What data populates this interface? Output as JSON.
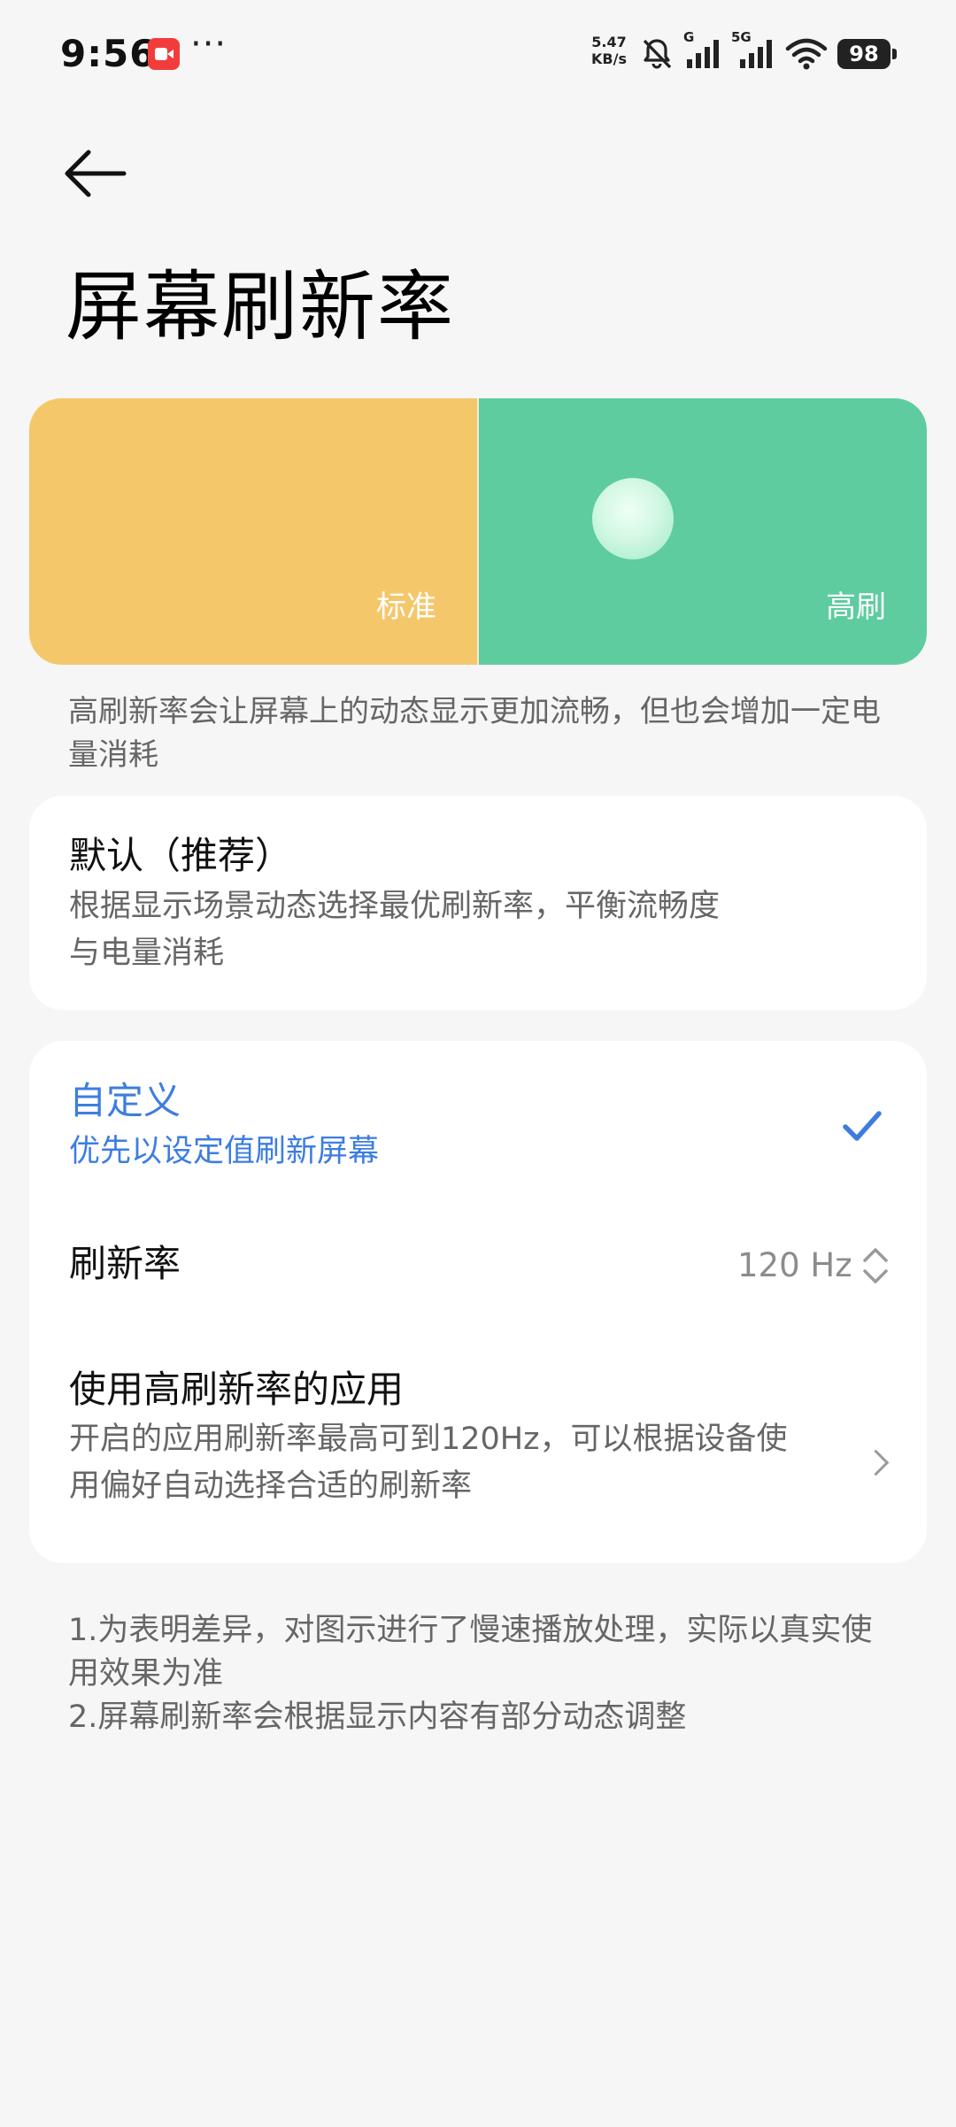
{
  "status_bar": {
    "time": "9:56",
    "more": "···",
    "net_speed_value": "5.47",
    "net_speed_unit": "KB/s",
    "sim1_label": "G",
    "sim2_label": "5G",
    "battery": "98"
  },
  "header": {
    "title": "屏幕刷新率"
  },
  "preview": {
    "standard_label": "标准",
    "high_label": "高刷"
  },
  "description": "高刷新率会让屏幕上的动态显示更加流畅，但也会增加一定电量消耗",
  "options": {
    "default": {
      "title": "默认（推荐）",
      "subtitle_line1": "根据显示场景动态选择最优刷新率，平衡流畅度",
      "subtitle_line2": "与电量消耗",
      "selected": false
    },
    "custom": {
      "title": "自定义",
      "subtitle": "优先以设定值刷新屏幕",
      "selected": true,
      "accent_color": "#3d7de0"
    },
    "refresh_rate": {
      "label": "刷新率",
      "value": "120 Hz"
    },
    "high_refresh_apps": {
      "title": "使用高刷新率的应用",
      "subtitle_line1": "开启的应用刷新率最高可到120Hz，可以根据设备使",
      "subtitle_line2": "用偏好自动选择合适的刷新率"
    }
  },
  "notes": {
    "line1": "1.为表明差异，对图示进行了慢速播放处理，实际以真实使",
    "line2": "用效果为准",
    "line3": "2.屏幕刷新率会根据显示内容有部分动态调整"
  },
  "colors": {
    "standard": "#f5c76b",
    "high": "#5ecc9f",
    "background": "#f6f6f6"
  }
}
